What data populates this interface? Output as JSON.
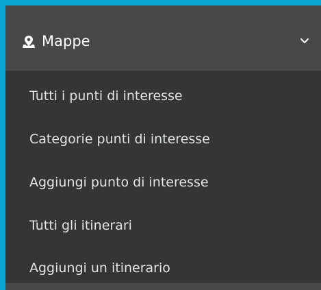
{
  "menu": {
    "header_label": "Mappe",
    "header_icon": "map-pin-icon",
    "expanded": true,
    "items": [
      {
        "label": "Tutti i punti di interesse"
      },
      {
        "label": "Categorie punti di interesse"
      },
      {
        "label": "Aggiungi punto di interesse"
      },
      {
        "label": "Tutti gli itinerari"
      },
      {
        "label": "Aggiungi un itinerario"
      }
    ]
  },
  "colors": {
    "border": "#0aa6d2",
    "header_bg": "#464849",
    "panel_bg": "#333536",
    "text": "#e3e4e4"
  }
}
